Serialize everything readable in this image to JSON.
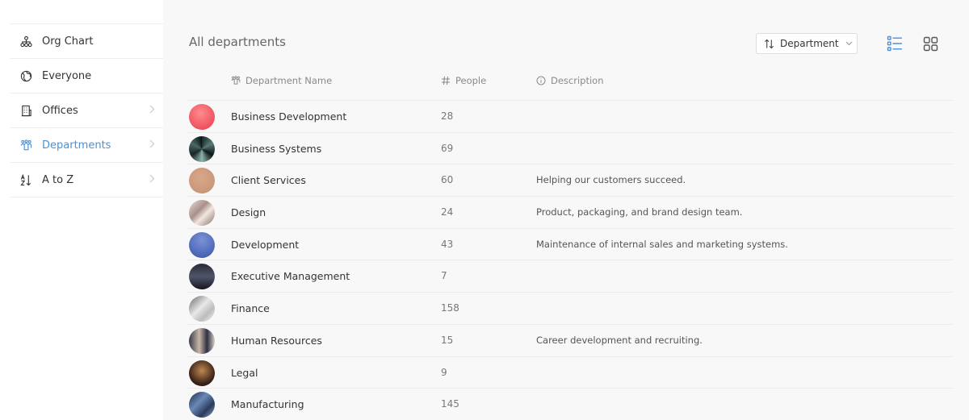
{
  "sidebar": {
    "items": [
      {
        "label": "Org Chart",
        "icon": "org-chart-icon",
        "active": false,
        "chevron": false
      },
      {
        "label": "Everyone",
        "icon": "globe-icon",
        "active": false,
        "chevron": false
      },
      {
        "label": "Offices",
        "icon": "building-icon",
        "active": false,
        "chevron": true
      },
      {
        "label": "Departments",
        "icon": "people-group-icon",
        "active": true,
        "chevron": true
      },
      {
        "label": "A to Z",
        "icon": "sort-alpha-icon",
        "active": false,
        "chevron": true
      }
    ]
  },
  "header": {
    "title": "All departments",
    "sort_label": "Department"
  },
  "table": {
    "columns": {
      "name": "Department Name",
      "people": "People",
      "description": "Description"
    },
    "rows": [
      {
        "name": "Business Development",
        "people": "28",
        "description": "",
        "avatar": "radial-gradient(circle at 45% 35%, #ff8c8c, #e8394d)"
      },
      {
        "name": "Business Systems",
        "people": "69",
        "description": "",
        "avatar": "conic-gradient(from 0deg, #1a2a2a, #5a7a78, #0e1616, #8fb5b0, #1a2626, #4a6866, #0c1414)"
      },
      {
        "name": "Client Services",
        "people": "60",
        "description": "Helping our customers succeed.",
        "avatar": "radial-gradient(circle at 45% 40%, #d8a88a, #c48f72)"
      },
      {
        "name": "Design",
        "people": "24",
        "description": "Product, packaging, and brand design team.",
        "avatar": "linear-gradient(135deg, #e8ddd8, #a89088 40%, #f0e6e0 60%, #8a6e66)"
      },
      {
        "name": "Development",
        "people": "43",
        "description": "Maintenance of internal sales and marketing systems.",
        "avatar": "radial-gradient(circle at 50% 30%, #7a92d6, #3a55a8)"
      },
      {
        "name": "Executive Management",
        "people": "7",
        "description": "",
        "avatar": "linear-gradient(180deg, #2a2a35, #50556a 50%, #15151c)"
      },
      {
        "name": "Finance",
        "people": "158",
        "description": "",
        "avatar": "linear-gradient(135deg, #6a6a6a, #e8e8e8 45%, #bcbcbc 70%, #f4f4f4)"
      },
      {
        "name": "Human Resources",
        "people": "15",
        "description": "Career development and recruiting.",
        "avatar": "linear-gradient(90deg, #3a3a48, #c8b8a8 40%, #2e3040 70%, #d8cfc4)"
      },
      {
        "name": "Legal",
        "people": "9",
        "description": "",
        "avatar": "radial-gradient(circle at 50% 40%, #c08850, #3a2218 65%, #1a0e0a)"
      },
      {
        "name": "Manufacturing",
        "people": "145",
        "description": "",
        "avatar": "linear-gradient(135deg, #1a2a4a, #6a8ab8 40%, #2a3a5a 70%, #9ab0d0)"
      }
    ]
  },
  "colors": {
    "accent": "#4a90d9",
    "sidebar_bg": "#ffffff",
    "main_bg": "#f8f8f8"
  }
}
